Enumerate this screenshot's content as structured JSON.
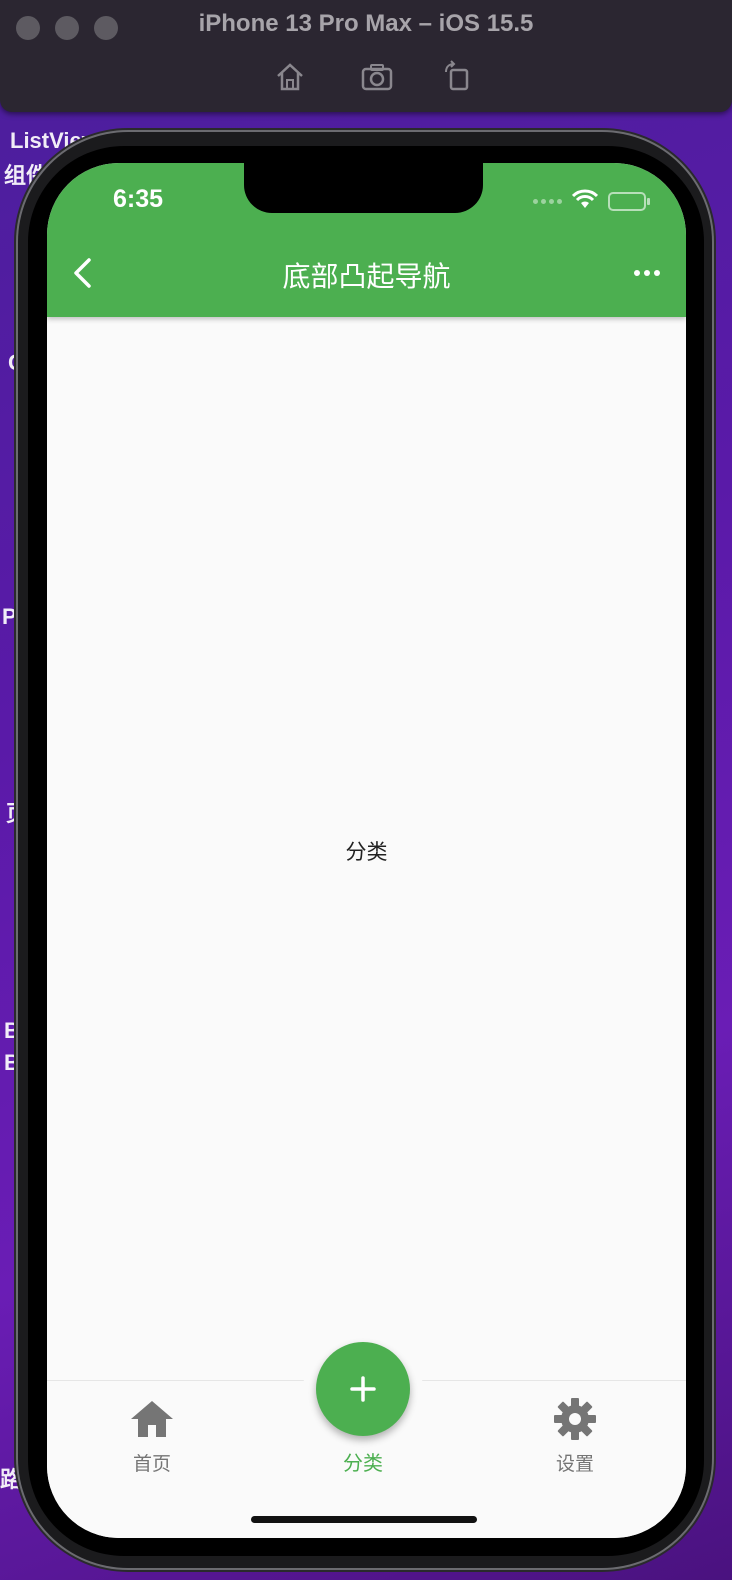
{
  "simulator": {
    "title": "iPhone 13 Pro Max – iOS 15.5",
    "icons": [
      "home-icon",
      "screenshot-icon",
      "rotate-icon"
    ]
  },
  "desktop_fragments": {
    "line1": "ListView",
    "line2": "组件",
    "left_c": "C",
    "left_p": "P",
    "left_ye": "页",
    "left_b1": "B",
    "left_b2": "B",
    "left_lu": "路"
  },
  "status_bar": {
    "time": "6:35"
  },
  "app_bar": {
    "title": "底部凸起导航",
    "back_icon": "chevron-left-icon",
    "more_icon": "more-horizontal-icon"
  },
  "content": {
    "text": "分类"
  },
  "bottom_nav": {
    "items": [
      {
        "label": "首页",
        "icon": "home-icon"
      },
      {
        "label": "分类",
        "icon": "plus-icon"
      },
      {
        "label": "设置",
        "icon": "settings-icon"
      }
    ],
    "selected_index": 1
  },
  "colors": {
    "primary": "#4caf50",
    "inactive": "#757575",
    "background": "#fafafa"
  }
}
